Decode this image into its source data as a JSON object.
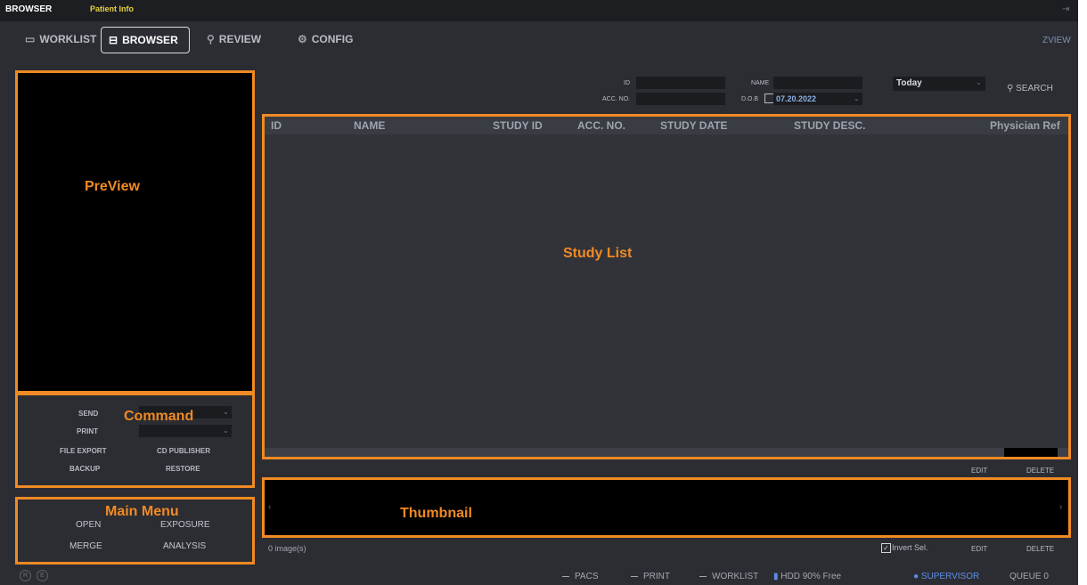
{
  "app": {
    "title": "BROWSER",
    "subtitle": "Patient Info",
    "brand": "ZVIEW"
  },
  "nav": {
    "worklist": "WORKLIST",
    "browser": "BROWSER",
    "review": "REVIEW",
    "config": "CONFIG"
  },
  "search": {
    "id_label": "ID",
    "acc_label": "ACC. NO.",
    "name_label": "NAME",
    "dob_label": "D.O.B",
    "dob_value": "07.20.2022",
    "range_value": "Today",
    "search_label": "SEARCH"
  },
  "columns": [
    "ID",
    "NAME",
    "STUDY ID",
    "ACC. NO.",
    "STUDY DATE",
    "STUDY DESC.",
    "Physician Ref"
  ],
  "annotations": {
    "preview": "PreView",
    "study_list": "Study List",
    "command": "Command",
    "main_menu": "Main Menu",
    "thumbnail": "Thumbnail"
  },
  "command": {
    "send": "SEND",
    "print": "PRINT",
    "file_export": "FILE EXPORT",
    "cd_publisher": "CD PUBLISHER",
    "backup": "BACKUP",
    "restore": "RESTORE"
  },
  "main_menu": {
    "open": "OPEN",
    "exposure": "EXPOSURE",
    "merge": "MERGE",
    "analysis": "ANALYSIS"
  },
  "study_actions": {
    "edit": "EDIT",
    "delete": "DELETE"
  },
  "thumbnail": {
    "count": "0 image(s)",
    "invert": "Invert Sel.",
    "edit": "EDIT",
    "delete": "DELETE"
  },
  "status": {
    "pacs": "PACS",
    "print": "PRINT",
    "worklist": "WORKLIST",
    "hdd": "HDD  90% Free",
    "user": "SUPERVISOR",
    "queue": "QUEUE  0",
    "r": "R",
    "e": "E"
  },
  "colors": {
    "accent": "#f08a24",
    "background": "#2c2d33",
    "panel": "#000000",
    "subtitle": "#e6d23c"
  }
}
